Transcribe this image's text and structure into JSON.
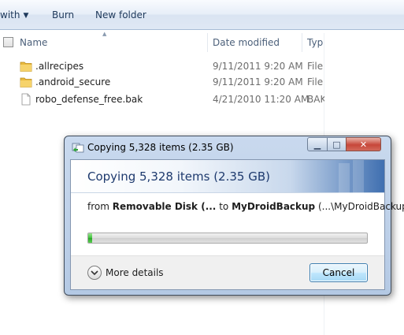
{
  "toolbar": {
    "organize_tail": "with",
    "burn_label": "Burn",
    "new_folder_label": "New folder"
  },
  "columns": {
    "name": "Name",
    "date_modified": "Date modified",
    "type": "Typ"
  },
  "files": [
    {
      "name": ".allrecipes",
      "date": "9/11/2011 9:20 AM",
      "type": "File",
      "icon": "folder-icon"
    },
    {
      "name": ".android_secure",
      "date": "9/11/2011 9:20 AM",
      "type": "File",
      "icon": "folder-icon"
    },
    {
      "name": "robo_defense_free.bak",
      "date": "4/21/2010 11:20 AM",
      "type": "BAK",
      "icon": "file-icon"
    }
  ],
  "dialog": {
    "title": "Copying 5,328 items (2.35 GB)",
    "heading": "Copying 5,328 items (2.35 GB)",
    "from_word": "from",
    "source": "Removable Disk (...",
    "to_word": "to",
    "destination": "MyDroidBackup",
    "destination_path": "(...\\MyDroidBackup)",
    "progress_percent": 1.5,
    "more_details_label": "More details",
    "cancel_label": "Cancel"
  },
  "colors": {
    "progress_green": "#3cc03a",
    "banner_blue": "#3f6fb0",
    "close_red": "#c7473a"
  }
}
